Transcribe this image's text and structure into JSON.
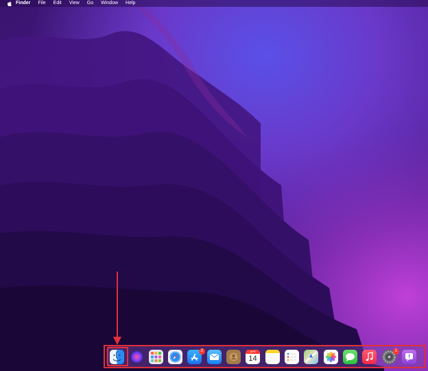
{
  "menubar": {
    "apple_icon": "apple-logo-icon",
    "app_name": "Finder",
    "items": [
      "File",
      "Edit",
      "View",
      "Go",
      "Window",
      "Help"
    ]
  },
  "dock": {
    "apps": [
      {
        "name": "Finder",
        "icon": "finder-icon"
      },
      {
        "name": "Siri",
        "icon": "siri-icon"
      },
      {
        "name": "Launchpad",
        "icon": "launchpad-icon"
      },
      {
        "name": "Safari",
        "icon": "safari-icon"
      },
      {
        "name": "App Store",
        "icon": "app-store-icon",
        "badge": "2"
      },
      {
        "name": "Mail",
        "icon": "mail-icon"
      },
      {
        "name": "Contacts",
        "icon": "contacts-icon"
      },
      {
        "name": "Calendar",
        "icon": "calendar-icon",
        "month": "APR",
        "day": "14"
      },
      {
        "name": "Notes",
        "icon": "notes-icon"
      },
      {
        "name": "Reminders",
        "icon": "reminders-icon"
      },
      {
        "name": "Maps",
        "icon": "maps-icon"
      },
      {
        "name": "Photos",
        "icon": "photos-icon"
      },
      {
        "name": "Messages",
        "icon": "messages-icon"
      },
      {
        "name": "Music",
        "icon": "music-icon"
      },
      {
        "name": "System Preferences",
        "icon": "system-preferences-icon",
        "badge": "1"
      },
      {
        "name": "Feedback Assistant",
        "icon": "feedback-assistant-icon"
      }
    ]
  },
  "colors": {
    "highlight": "#e0303a",
    "wallpaper_dark": "#1a0838",
    "wallpaper_mid": "#4a1a8a",
    "wallpaper_bright": "#b040d0"
  }
}
